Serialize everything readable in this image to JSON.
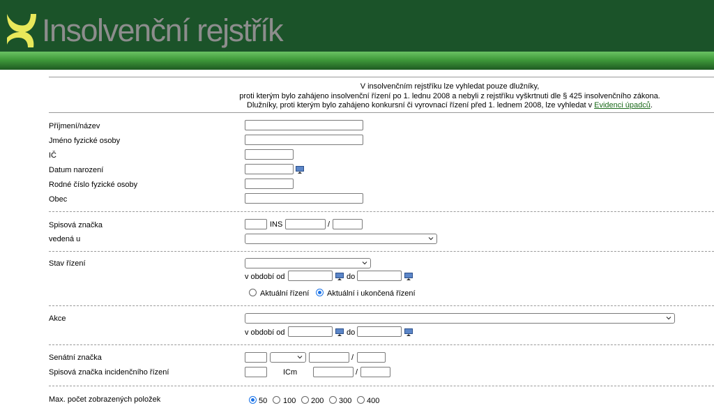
{
  "header": {
    "title": "Insolvenční rejstřík"
  },
  "notice": {
    "line1": "V insolvenčním rejstříku lze vyhledat pouze dlužníky,",
    "line2": "proti kterým bylo zahájeno insolvenční řízení po 1. lednu 2008 a nebyli z rejstříku vyškrtnuti dle § 425 insolvenčního zákona.",
    "line3": "Dlužníky, proti kterým bylo zahájeno konkursní či vyrovnací řízení před 1. lednem 2008, lze vyhledat v",
    "link": "Evidenci úpadců",
    "line3_end": "."
  },
  "form": {
    "prijmeni": "Příjmení/název",
    "jmeno": "Jméno fyzické osoby",
    "ic": "IČ",
    "datum": "Datum narození",
    "rodne": "Rodné číslo fyzické osoby",
    "obec": "Obec",
    "spisova": "Spisová značka",
    "ins": "INS",
    "slash": "/",
    "vedena": "vedená u",
    "stav": "Stav řízení",
    "obdobi_od": "v období od",
    "do": "do",
    "aktualni": "Aktuální řízení",
    "aktualni_ukoncena": "Aktuální i ukončená řízení",
    "akce": "Akce",
    "senatni": "Senátní značka",
    "incidencni": "Spisová značka incidenčního řízení",
    "icm": "ICm",
    "max": "Max. počet zobrazených položek",
    "counts": [
      "50",
      "100",
      "200",
      "300",
      "400"
    ]
  },
  "colors": {
    "header_bg": "#1b5329",
    "band": "#3f9a3a",
    "title": "#8d8d8d",
    "logo": "#e8e85a",
    "link": "#1a6a1a"
  }
}
